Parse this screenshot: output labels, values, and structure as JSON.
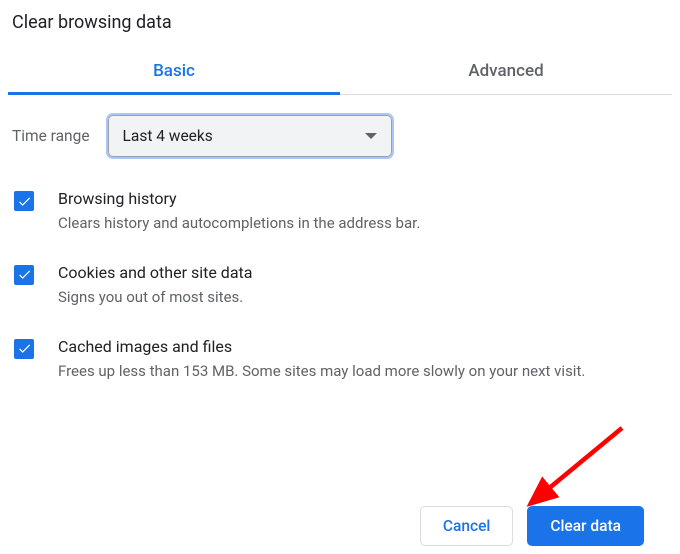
{
  "title": "Clear browsing data",
  "tabs": {
    "basic": "Basic",
    "advanced": "Advanced"
  },
  "time": {
    "label": "Time range",
    "selected": "Last 4 weeks"
  },
  "options": [
    {
      "title": "Browsing history",
      "desc": "Clears history and autocompletions in the address bar."
    },
    {
      "title": "Cookies and other site data",
      "desc": "Signs you out of most sites."
    },
    {
      "title": "Cached images and files",
      "desc": "Frees up less than 153 MB. Some sites may load more slowly on your next visit."
    }
  ],
  "buttons": {
    "cancel": "Cancel",
    "clear": "Clear data"
  }
}
